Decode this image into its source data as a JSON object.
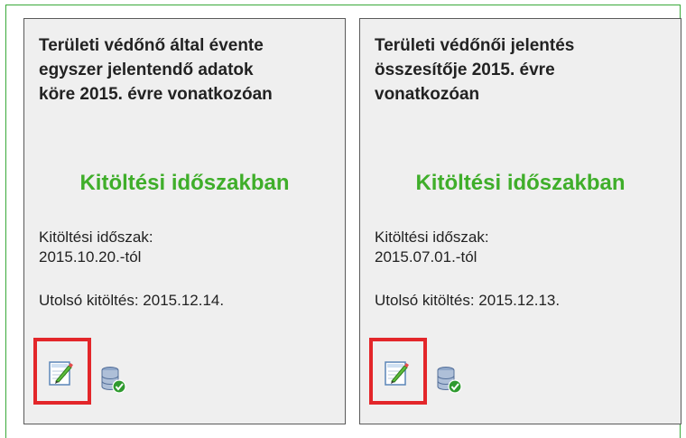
{
  "cards": [
    {
      "title": "Területi védőnő által évente\negyszer jelentendő adatok\nköre 2015. évre vonatkozóan",
      "status": "Kitöltési időszakban",
      "period_label": "Kitöltési időszak:",
      "period_value": "2015.10.20.-tól",
      "last_fill_label": "Utolsó kitöltés:",
      "last_fill_value": "2015.12.14.",
      "edit_icon": "edit-document-icon",
      "db_icon": "database-check-icon"
    },
    {
      "title": "Területi védőnői jelentés\nösszesítője 2015. évre\nvonatkozóan",
      "status": "Kitöltési időszakban",
      "period_label": "Kitöltési időszak:",
      "period_value": "2015.07.01.-tól",
      "last_fill_label": "Utolsó kitöltés:",
      "last_fill_value": "2015.12.13.",
      "edit_icon": "edit-document-icon",
      "db_icon": "database-check-icon"
    }
  ],
  "colors": {
    "status_green": "#3fae2a",
    "highlight_red": "#e3262a",
    "frame_green": "#3aa93a",
    "card_bg": "#efefef"
  }
}
